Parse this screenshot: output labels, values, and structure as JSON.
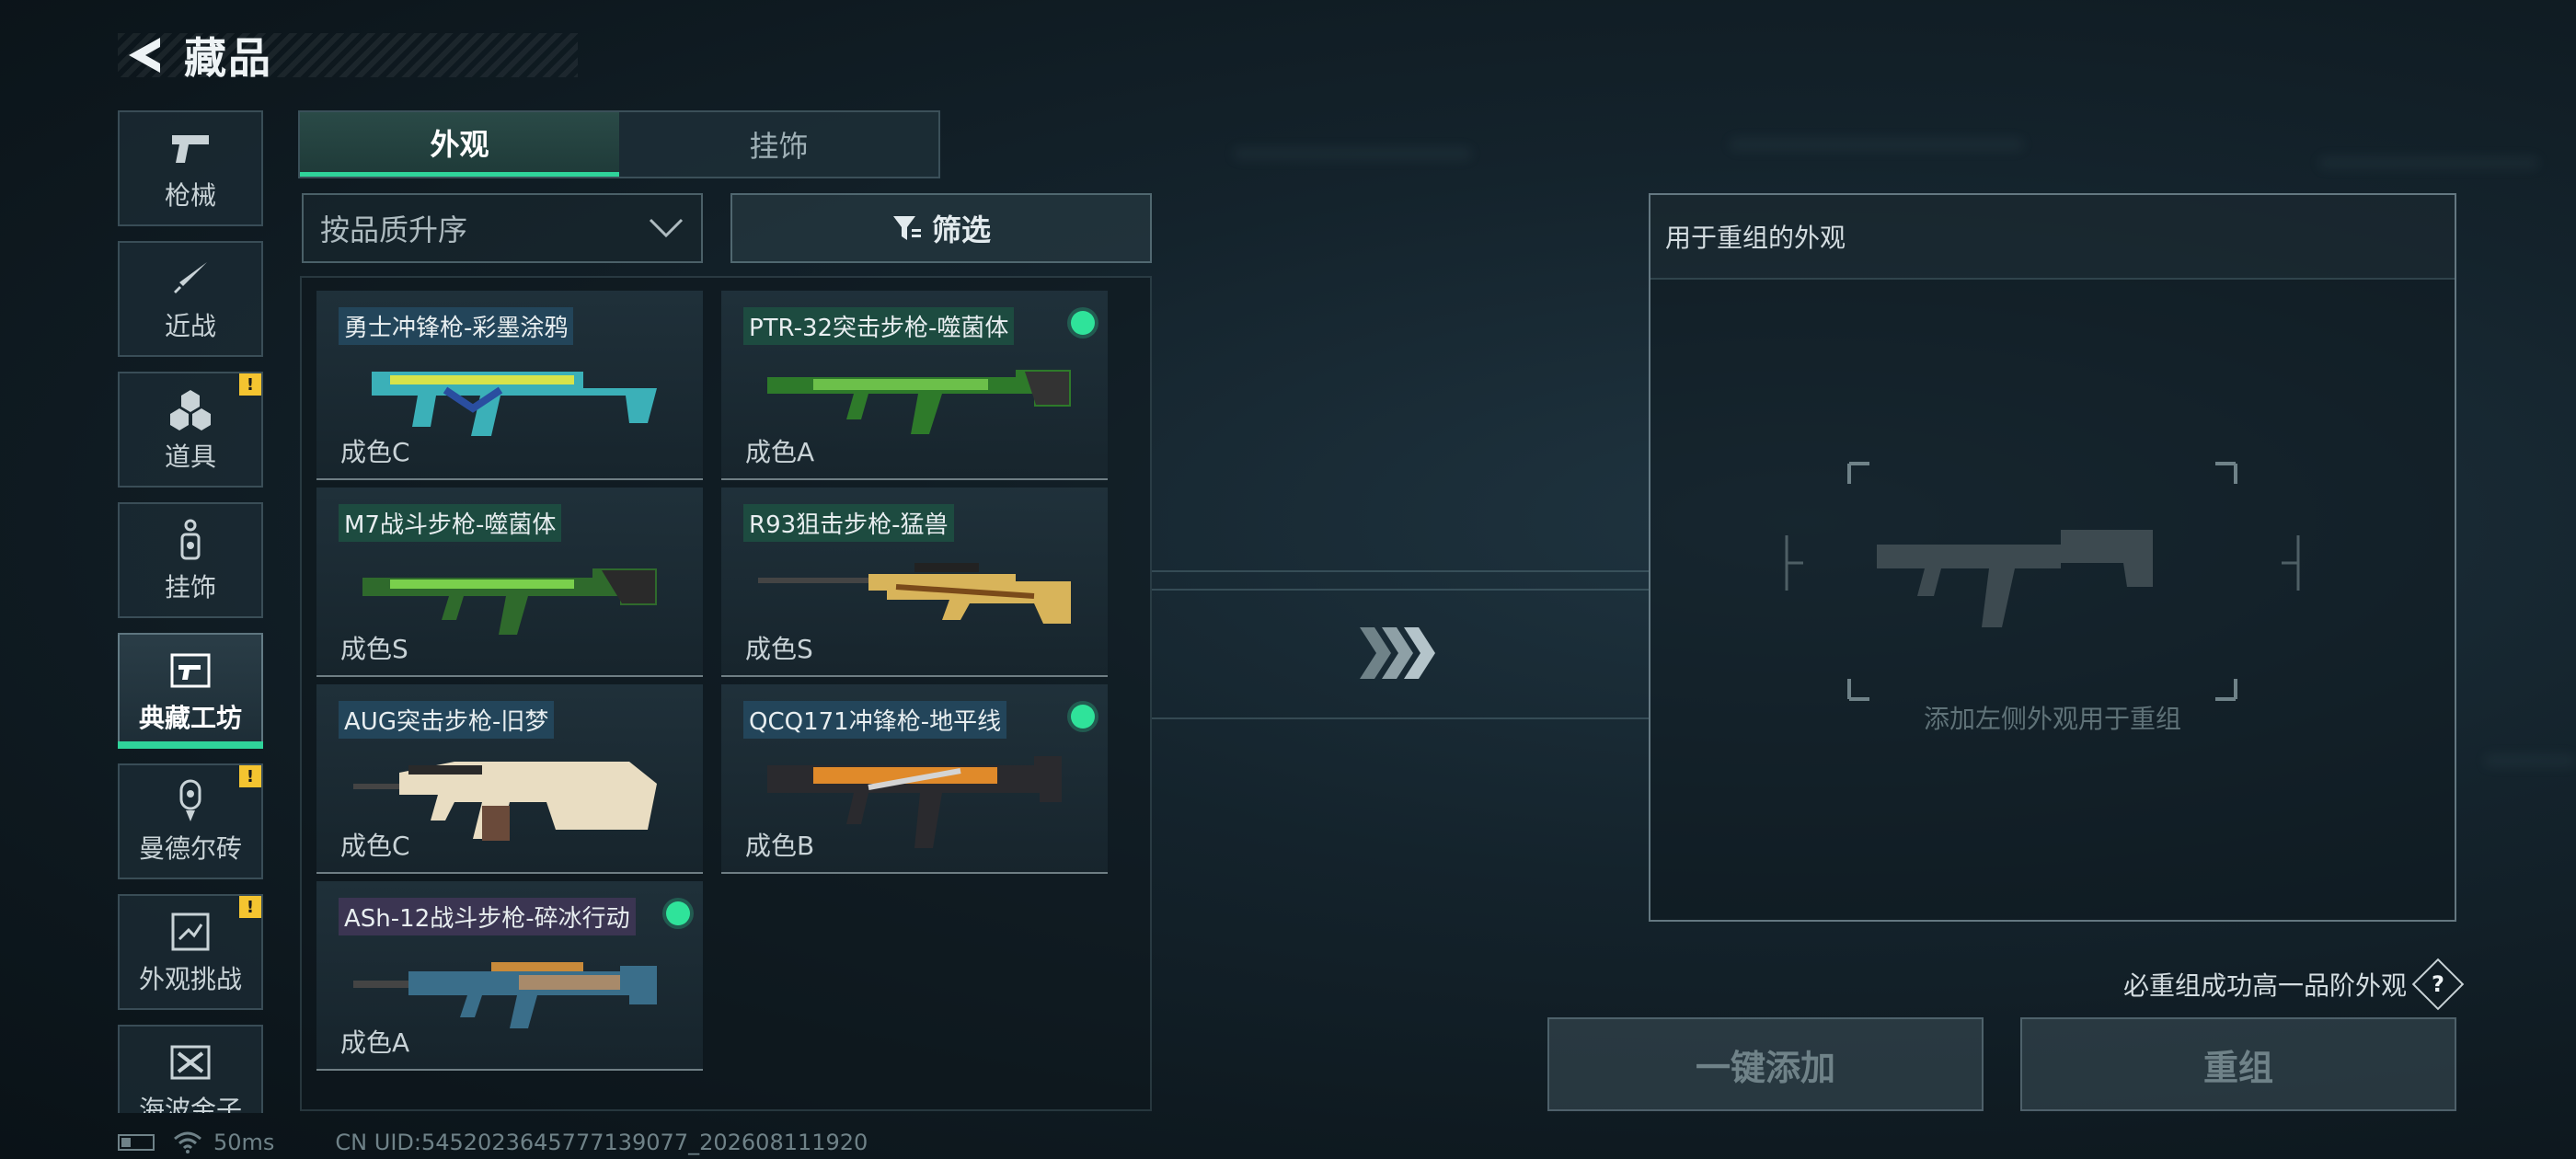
{
  "header": {
    "title": "藏品"
  },
  "nav": {
    "items": [
      {
        "label": "枪械",
        "icon": "pistol-icon",
        "alert": false,
        "active": false
      },
      {
        "label": "近战",
        "icon": "knife-icon",
        "alert": false,
        "active": false
      },
      {
        "label": "道具",
        "icon": "grenade-icon",
        "alert": true,
        "active": false
      },
      {
        "label": "挂饰",
        "icon": "charm-icon",
        "alert": false,
        "active": false
      },
      {
        "label": "典藏工坊",
        "icon": "workshop-icon",
        "alert": false,
        "active": true
      },
      {
        "label": "曼德尔砖",
        "icon": "brick-icon",
        "alert": true,
        "active": false
      },
      {
        "label": "外观挑战",
        "icon": "challenge-icon",
        "alert": true,
        "active": false
      },
      {
        "label": "海波金子",
        "icon": "gold-icon",
        "alert": false,
        "active": false
      }
    ],
    "alert_mark": "!"
  },
  "tabs": [
    {
      "label": "外观",
      "active": true
    },
    {
      "label": "挂饰",
      "active": false
    }
  ],
  "toolbar": {
    "sort_label": "按品质升序",
    "filter_label": "筛选"
  },
  "skins": [
    {
      "name": "勇士冲锋枪-彩墨涂鸦",
      "grade": "成色C",
      "equipped": false,
      "tag": "c"
    },
    {
      "name": "PTR-32突击步枪-噬菌体",
      "grade": "成色A",
      "equipped": true,
      "tag": "a"
    },
    {
      "name": "M7战斗步枪-噬菌体",
      "grade": "成色S",
      "equipped": false,
      "tag": "s"
    },
    {
      "name": "R93狙击步枪-猛兽",
      "grade": "成色S",
      "equipped": false,
      "tag": "s"
    },
    {
      "name": "AUG突击步枪-旧梦",
      "grade": "成色C",
      "equipped": false,
      "tag": "c"
    },
    {
      "name": "QCQ171冲锋枪-地平线",
      "grade": "成色B",
      "equipped": true,
      "tag": "b"
    },
    {
      "name": "ASh-12战斗步枪-碎冰行动",
      "grade": "成色A",
      "equipped": true,
      "tag": "p"
    }
  ],
  "recombine": {
    "title": "用于重组的外观",
    "hint": "添加左侧外观用于重组",
    "rule_note": "必重组成功高一品阶外观",
    "help": "?",
    "quick_add_label": "一键添加",
    "recombine_label": "重组"
  },
  "status": {
    "ping": "50ms",
    "uid": "CN UID:5452023645777139077_202608111920"
  },
  "colors": {
    "accent": "#2fd39a",
    "alert": "#f4c430",
    "equipped": "#2fe39a"
  }
}
